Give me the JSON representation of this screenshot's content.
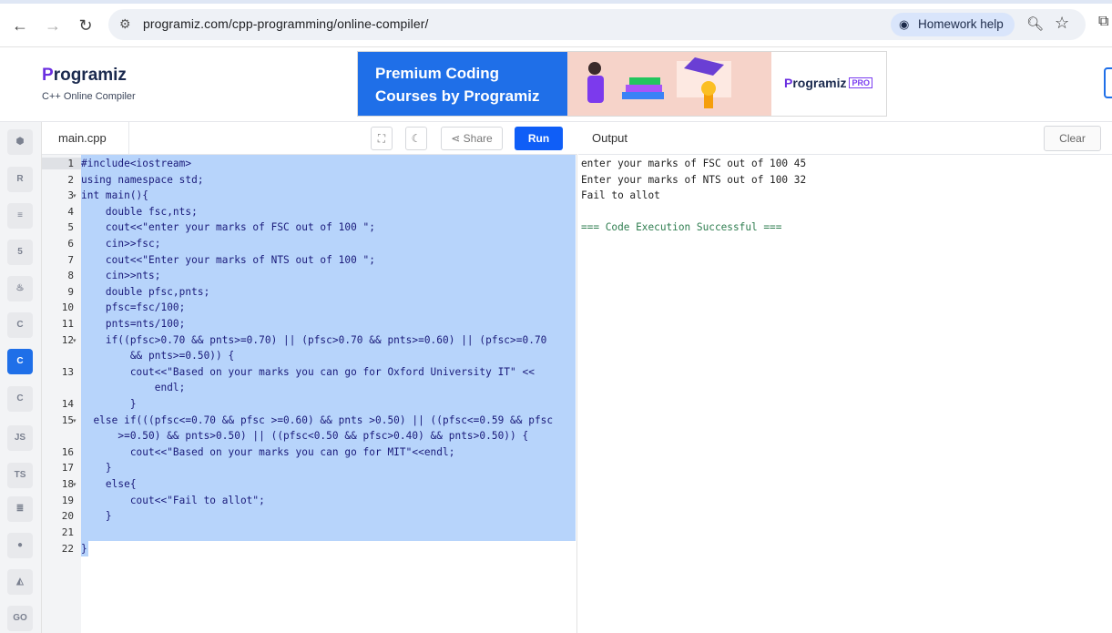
{
  "browser": {
    "url": "programiz.com/cpp-programming/online-compiler/",
    "homework_help": "Homework help"
  },
  "header": {
    "logo": "rogramiz",
    "logo_initial": "P",
    "subtitle": "C++ Online Compiler",
    "banner_text": "Premium Coding Courses by Programiz",
    "banner_logo": "rogramiz",
    "banner_logo_initial": "P",
    "banner_pro": "PRO"
  },
  "sidebar": {
    "languages": [
      "python",
      "r",
      "sql",
      "html",
      "java",
      "c",
      "cpp",
      "csharp",
      "js",
      "ts",
      "go-lang",
      "php",
      "swift",
      "rust",
      "go"
    ],
    "labels": {
      "js": "JS",
      "ts": "TS",
      "go": "GO"
    },
    "active": "cpp"
  },
  "editor": {
    "file_tab": "main.cpp",
    "share_label": "Share",
    "run_label": "Run",
    "line_numbers": [
      "1",
      "2",
      "3",
      "4",
      "5",
      "6",
      "7",
      "8",
      "9",
      "10",
      "11",
      "12",
      "",
      "13",
      "",
      "14",
      "15",
      "",
      "16",
      "17",
      "18",
      "19",
      "20",
      "21",
      "22"
    ],
    "code_lines": [
      "#include<iostream>",
      "using namespace std;",
      "int main(){",
      "    double fsc,nts;",
      "    cout<<\"enter your marks of FSC out of 100 \";",
      "    cin>>fsc;",
      "    cout<<\"Enter your marks of NTS out of 100 \";",
      "    cin>>nts;",
      "    double pfsc,pnts;",
      "    pfsc=fsc/100;",
      "    pnts=nts/100;",
      "    if((pfsc>0.70 && pnts>=0.70) || (pfsc>0.70 && pnts>=0.60) || (pfsc>=0.70",
      "        && pnts>=0.50)) {",
      "        cout<<\"Based on your marks you can go for Oxford University IT\" <<",
      "            endl;",
      "        }",
      "  else if(((pfsc<=0.70 && pfsc >=0.60) && pnts >0.50) || ((pfsc<=0.59 && pfsc",
      "      >=0.50) && pnts>0.50) || ((pfsc<0.50 && pfsc>0.40) && pnts>0.50)) {",
      "        cout<<\"Based on your marks you can go for MIT\"<<endl;",
      "    }",
      "    else{",
      "        cout<<\"Fail to allot\";",
      "    }",
      "",
      "}"
    ]
  },
  "output": {
    "label": "Output",
    "clear_label": "Clear",
    "lines": [
      "enter your marks of FSC out of 100 45",
      "Enter your marks of NTS out of 100 32",
      "Fail to allot",
      "",
      "=== Code Execution Successful ==="
    ]
  }
}
